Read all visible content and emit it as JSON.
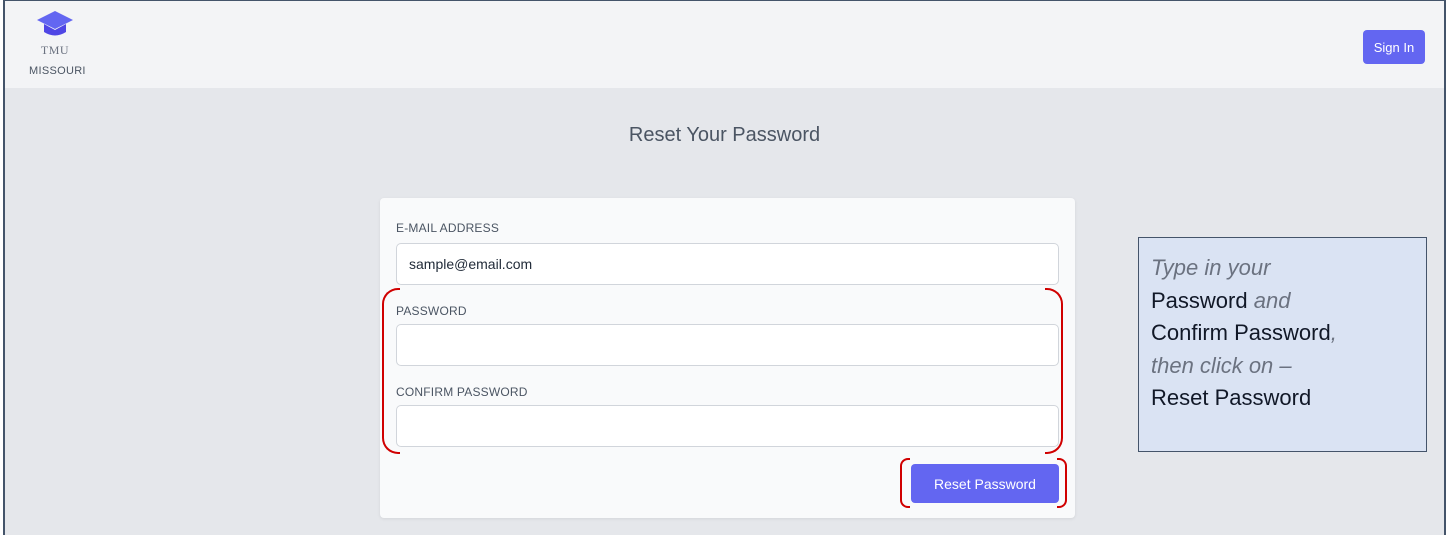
{
  "header": {
    "logo_abbr": "TMU",
    "logo_state": "MISSOURI",
    "signin_label": "Sign In"
  },
  "page": {
    "title": "Reset Your Password"
  },
  "form": {
    "email_label": "E-MAIL ADDRESS",
    "email_value": "sample@email.com",
    "password_label": "PASSWORD",
    "password_value": "",
    "confirm_label": "CONFIRM PASSWORD",
    "confirm_value": "",
    "submit_label": "Reset Password"
  },
  "annotation": {
    "part1": "Type in your",
    "part2": "Password",
    "part3": "and",
    "part4": "Confirm Password",
    "part5": ",",
    "part6": "then click on –",
    "part7": "Reset Password"
  },
  "colors": {
    "accent": "#6366f1",
    "highlight": "#d00000",
    "callout_bg": "#dae3f3"
  },
  "icons": {
    "logo": "graduation-cap-icon"
  }
}
